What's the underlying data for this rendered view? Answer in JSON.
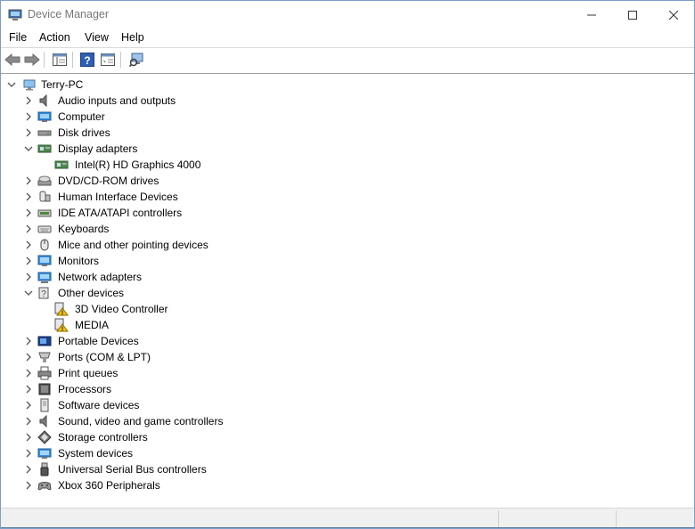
{
  "window": {
    "title": "Device Manager"
  },
  "menu": [
    "File",
    "Action",
    "View",
    "Help"
  ],
  "toolbar": [
    "back-icon",
    "forward-icon",
    "show-hide-console-tree-icon",
    "help-icon",
    "properties-icon",
    "scan-hardware-icon"
  ],
  "tree": {
    "root": "Terry-PC",
    "categories": [
      {
        "label": "Audio inputs and outputs",
        "icon": "speaker-icon",
        "expanded": false
      },
      {
        "label": "Computer",
        "icon": "computer-icon",
        "expanded": false
      },
      {
        "label": "Disk drives",
        "icon": "disk-drive-icon",
        "expanded": false
      },
      {
        "label": "Display adapters",
        "icon": "display-adapter-icon",
        "expanded": true,
        "children": [
          "Intel(R) HD Graphics 4000"
        ]
      },
      {
        "label": "DVD/CD-ROM drives",
        "icon": "dvd-drive-icon",
        "expanded": false
      },
      {
        "label": "Human Interface Devices",
        "icon": "hid-icon",
        "expanded": false
      },
      {
        "label": "IDE ATA/ATAPI controllers",
        "icon": "ide-controller-icon",
        "expanded": false
      },
      {
        "label": "Keyboards",
        "icon": "keyboard-icon",
        "expanded": false
      },
      {
        "label": "Mice and other pointing devices",
        "icon": "mouse-icon",
        "expanded": false
      },
      {
        "label": "Monitors",
        "icon": "monitor-icon",
        "expanded": false
      },
      {
        "label": "Network adapters",
        "icon": "network-adapter-icon",
        "expanded": false
      },
      {
        "label": "Other devices",
        "icon": "other-devices-icon",
        "expanded": true,
        "children": [
          "3D Video Controller",
          "MEDIA"
        ]
      },
      {
        "label": "Portable Devices",
        "icon": "portable-device-icon",
        "expanded": false
      },
      {
        "label": "Ports (COM & LPT)",
        "icon": "port-icon",
        "expanded": false
      },
      {
        "label": "Print queues",
        "icon": "printer-icon",
        "expanded": false
      },
      {
        "label": "Processors",
        "icon": "processor-icon",
        "expanded": false
      },
      {
        "label": "Software devices",
        "icon": "software-device-icon",
        "expanded": false
      },
      {
        "label": "Sound, video and game controllers",
        "icon": "sound-controller-icon",
        "expanded": false
      },
      {
        "label": "Storage controllers",
        "icon": "storage-controller-icon",
        "expanded": false
      },
      {
        "label": "System devices",
        "icon": "system-device-icon",
        "expanded": false
      },
      {
        "label": "Universal Serial Bus controllers",
        "icon": "usb-icon",
        "expanded": false
      },
      {
        "label": "Xbox 360 Peripherals",
        "icon": "gamepad-icon",
        "expanded": false
      }
    ]
  },
  "colors": {
    "accent": "#0078d7",
    "warning": "#f5c400",
    "window_border": "#7a9fc9"
  }
}
